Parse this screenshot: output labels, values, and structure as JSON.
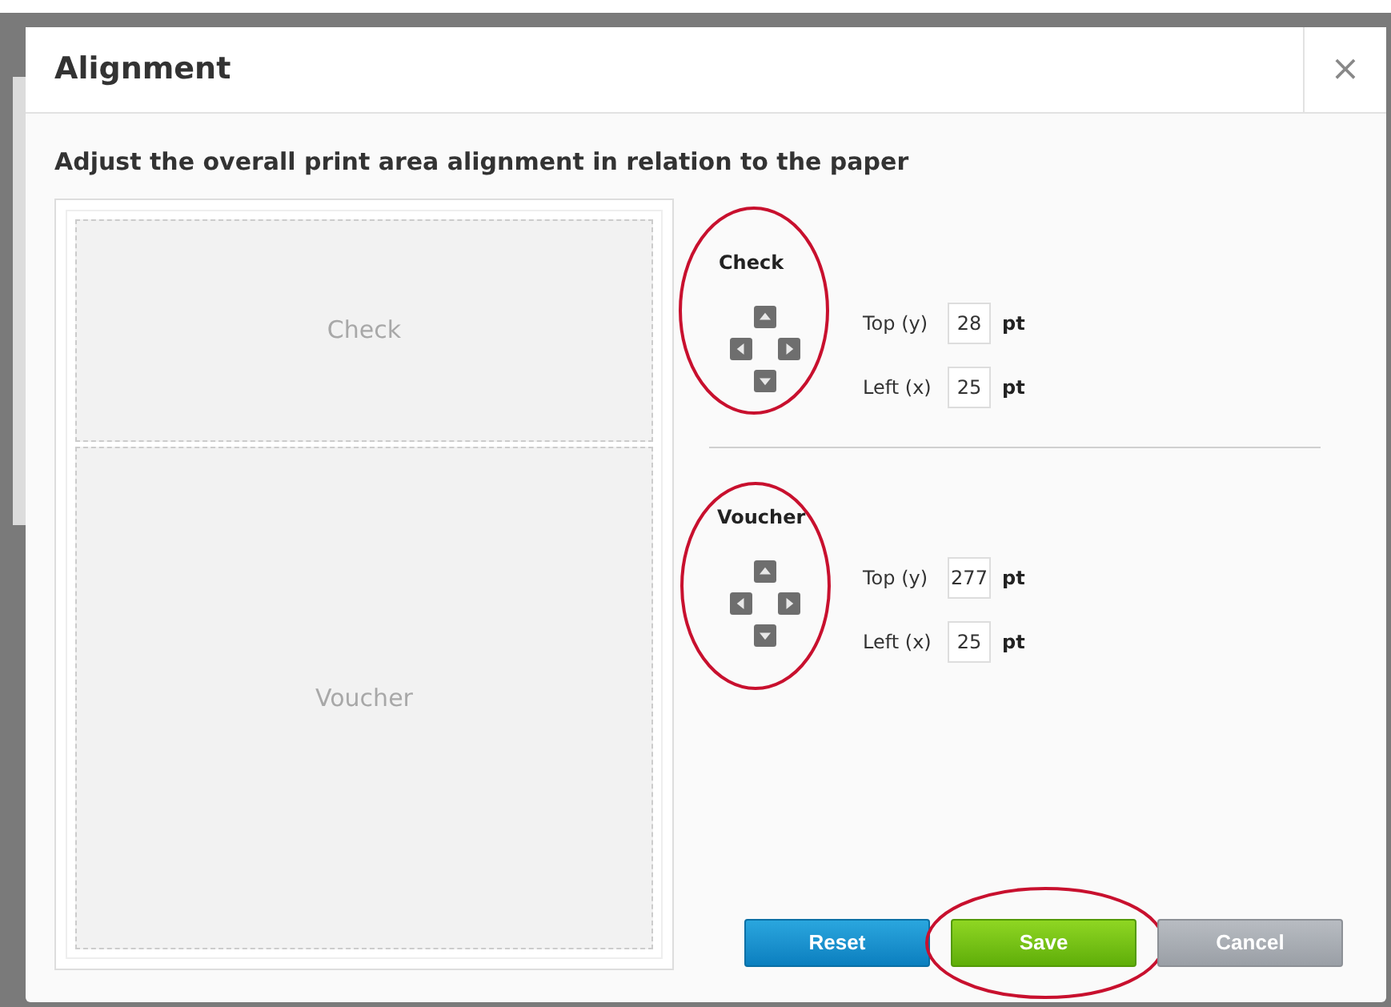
{
  "dialog": {
    "title": "Alignment",
    "close": "×",
    "instruction": "Adjust the overall print area alignment in relation to the paper"
  },
  "preview": {
    "areas": [
      {
        "label": "Check"
      },
      {
        "label": "Voucher"
      }
    ]
  },
  "sections": [
    {
      "title": "Check",
      "highlighted": true,
      "fields": [
        {
          "label": "Top (y)",
          "value": "28",
          "unit": "pt"
        },
        {
          "label": "Left (x)",
          "value": "25",
          "unit": "pt"
        }
      ]
    },
    {
      "title": "Voucher",
      "highlighted": true,
      "fields": [
        {
          "label": "Top (y)",
          "value": "277",
          "unit": "pt"
        },
        {
          "label": "Left (x)",
          "value": "25",
          "unit": "pt"
        }
      ]
    }
  ],
  "buttons": [
    {
      "label": "Reset",
      "kind": "reset",
      "highlighted": false
    },
    {
      "label": "Save",
      "kind": "save",
      "highlighted": true
    },
    {
      "label": "Cancel",
      "kind": "cancel",
      "highlighted": false
    }
  ]
}
